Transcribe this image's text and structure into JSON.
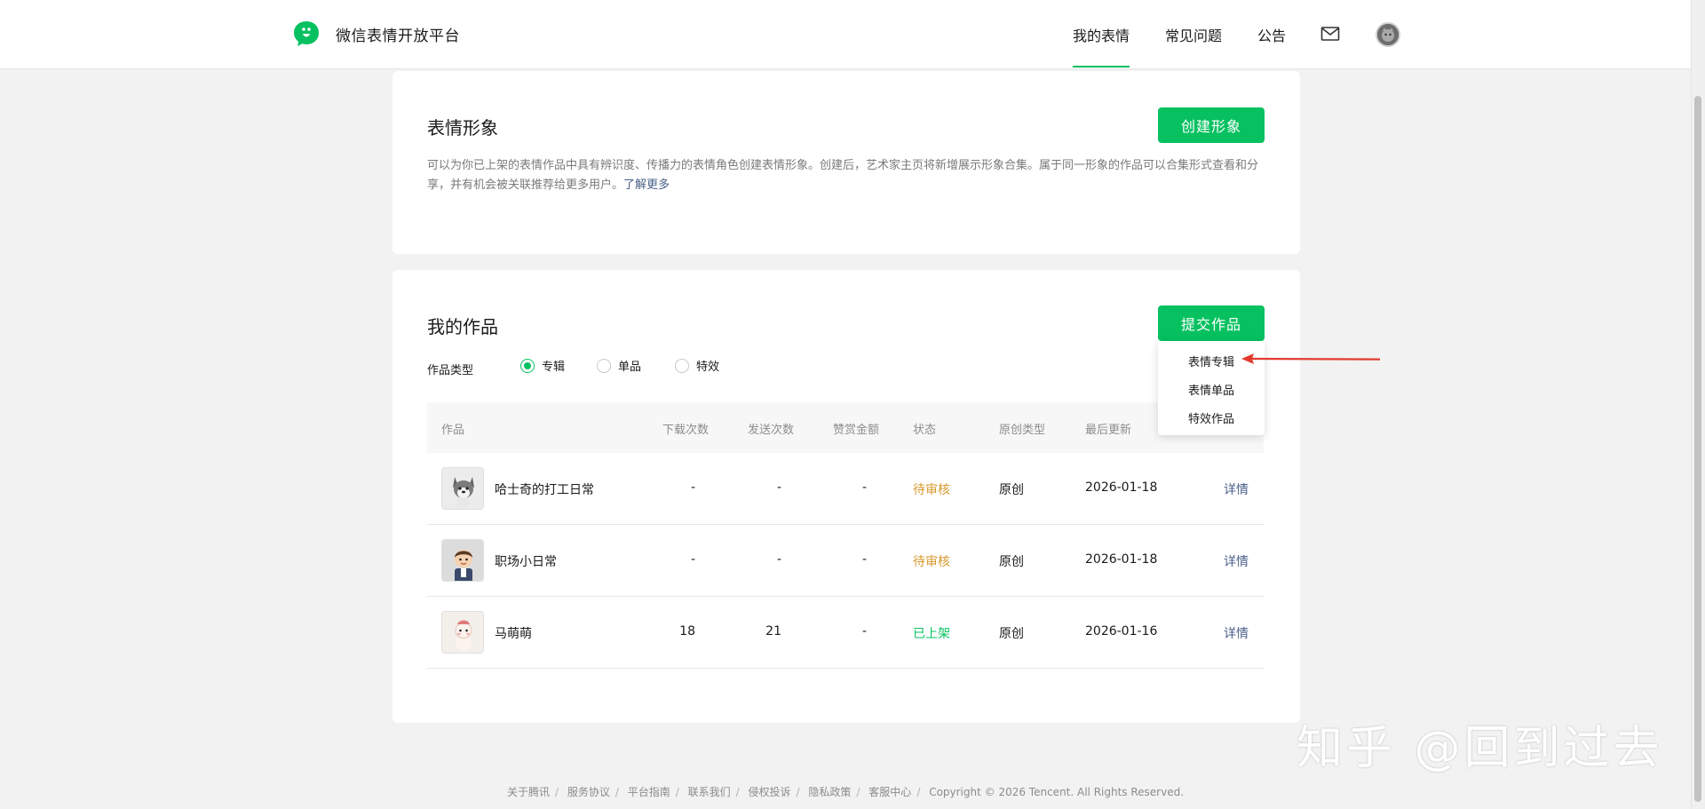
{
  "header": {
    "brand": "微信表情开放平台",
    "nav": [
      "我的表情",
      "常见问题",
      "公告"
    ],
    "active_nav": "我的表情",
    "mail_icon": "mail-icon",
    "avatar": "user-avatar"
  },
  "profile_section": {
    "title": "表情形象",
    "create_button": "创建形象",
    "description": "可以为你已上架的表情作品中具有辨识度、传播力的表情角色创建表情形象。创建后，艺术家主页将新增展示形象合集。属于同一形象的作品可以合集形式查看和分享，并有机会被关联推荐给更多用户。",
    "learn_more": "了解更多"
  },
  "works_section": {
    "title": "我的作品",
    "submit_button": "提交作品",
    "filter_label": "作品类型",
    "filter_options": [
      "专辑",
      "单品",
      "特效"
    ],
    "selected_filter": "专辑",
    "dropdown_items": [
      "表情专辑",
      "表情单品",
      "特效作品"
    ],
    "table": {
      "headers": [
        "作品",
        "下载次数",
        "发送次数",
        "赞赏金额",
        "状态",
        "原创类型",
        "最后更新"
      ],
      "rows": [
        {
          "name": "哈士奇的打工日常",
          "downloads": "-",
          "sends": "-",
          "tips": "-",
          "status": "待审核",
          "origin": "原创",
          "updated": "2026-01-18",
          "action": "详情"
        },
        {
          "name": "职场小日常",
          "downloads": "-",
          "sends": "-",
          "tips": "-",
          "status": "待审核",
          "origin": "原创",
          "updated": "2026-01-18",
          "action": "详情"
        },
        {
          "name": "马萌萌",
          "downloads": "18",
          "sends": "21",
          "tips": "-",
          "status": "已上架",
          "origin": "原创",
          "updated": "2026-01-16",
          "action": "详情"
        }
      ]
    }
  },
  "footer": {
    "links": [
      "关于腾讯",
      "服务协议",
      "平台指南",
      "联系我们",
      "侵权投诉",
      "隐私政策",
      "客服中心"
    ],
    "copyright": "Copyright © 2026 Tencent. All Rights Reserved."
  },
  "watermark": "知乎 @回到过去",
  "colors": {
    "brand_green": "#07c160",
    "pending": "#d69a2d",
    "link": "#4a6088",
    "annotation_red": "#e23b2e"
  }
}
